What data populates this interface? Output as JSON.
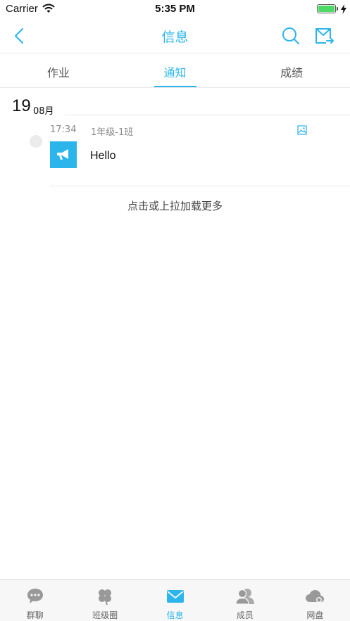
{
  "status_bar": {
    "carrier": "Carrier",
    "time": "5:35 PM"
  },
  "nav": {
    "title": "信息"
  },
  "tabs": [
    {
      "label": "作业",
      "active": false
    },
    {
      "label": "通知",
      "active": true
    },
    {
      "label": "成绩",
      "active": false
    }
  ],
  "date_header": {
    "day": "19",
    "month": "08月"
  },
  "messages": [
    {
      "time": "17:34",
      "class_name": "1年级-1班",
      "text": "Hello"
    }
  ],
  "load_more": "点击或上拉加载更多",
  "tab_bar": [
    {
      "label": "群聊",
      "icon": "chat-bubble-icon"
    },
    {
      "label": "班级圈",
      "icon": "clover-icon"
    },
    {
      "label": "信息",
      "icon": "envelope-icon",
      "active": true
    },
    {
      "label": "成员",
      "icon": "people-icon"
    },
    {
      "label": "网盘",
      "icon": "cloud-icon"
    }
  ],
  "colors": {
    "accent": "#2bb5ea",
    "tab_inactive": "#999999",
    "divider": "#e8e8e8"
  }
}
